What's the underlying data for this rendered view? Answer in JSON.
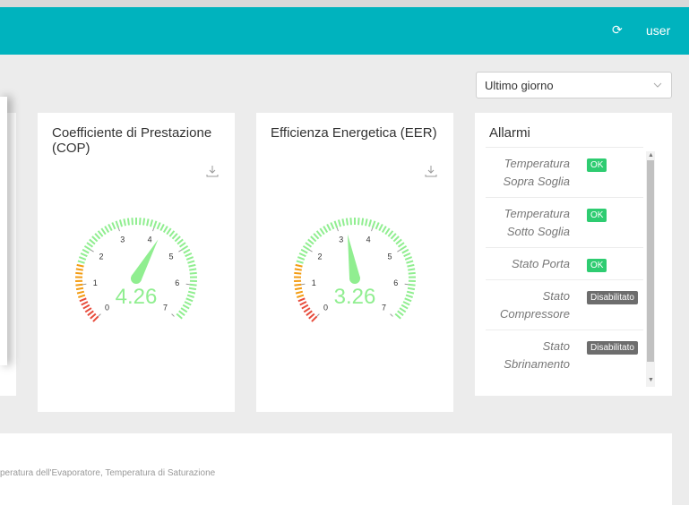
{
  "header": {
    "user_label": "user",
    "refresh_icon": "refresh-icon",
    "color": "#00b3be"
  },
  "period_select": {
    "value": "Ultimo giorno"
  },
  "cop_card": {
    "title": "Coefficiente di Prestazione (COP)",
    "value": "4.26",
    "value_num": 4.26,
    "min": 0,
    "max": 7,
    "ticks": [
      "0",
      "1",
      "2",
      "3",
      "4",
      "5",
      "6",
      "7"
    ]
  },
  "eer_card": {
    "title": "Efficienza Energetica (EER)",
    "value": "3.26",
    "value_num": 3.26,
    "min": 0,
    "max": 7,
    "ticks": [
      "0",
      "1",
      "2",
      "3",
      "4",
      "5",
      "6",
      "7"
    ]
  },
  "alarms": {
    "title": "Allarmi",
    "rows": [
      {
        "label": "Temperatura Sopra Soglia",
        "status": "OK"
      },
      {
        "label": "Temperatura Sotto Soglia",
        "status": "OK"
      },
      {
        "label": "Stato Porta",
        "status": "OK"
      },
      {
        "label": "Stato Compressore",
        "status": "Disabilitato"
      },
      {
        "label": "Stato Sbrinamento",
        "status": "Disabilitato"
      }
    ]
  },
  "bottom_chart": {
    "subtitle": "peratura dell'Evaporatore, Temperatura di Saturazione"
  },
  "colors": {
    "gauge_green": "#90ee90",
    "gauge_orange": "#f39c12",
    "gauge_red": "#e74c3c",
    "ok_badge": "#2ecc71",
    "disabled_badge": "#6d6d6d"
  }
}
